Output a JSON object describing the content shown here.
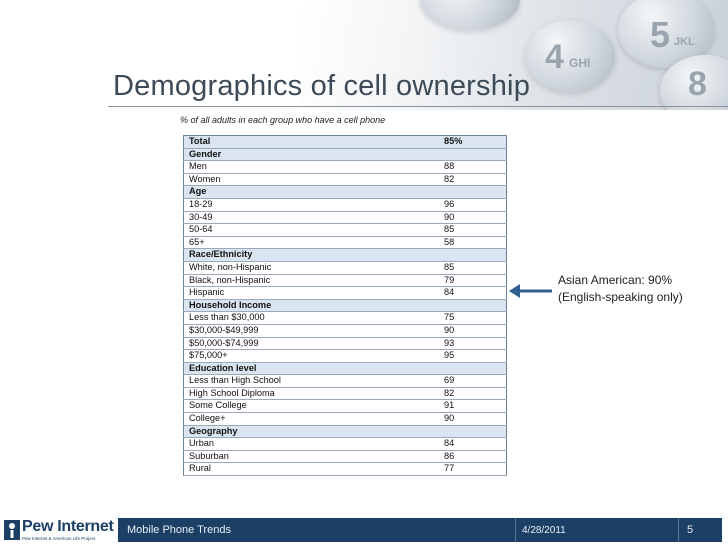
{
  "slide": {
    "title": "Demographics of cell ownership",
    "caption": "% of all adults in each group who have a cell phone",
    "note_line1": "Asian American: 90%",
    "note_line2": "(English-speaking only)"
  },
  "table": {
    "total": {
      "label": "Total",
      "value": "85%"
    },
    "sections": [
      {
        "header": "Gender",
        "rows": [
          {
            "label": "Men",
            "value": "88"
          },
          {
            "label": "Women",
            "value": "82"
          }
        ]
      },
      {
        "header": "Age",
        "rows": [
          {
            "label": "18-29",
            "value": "96"
          },
          {
            "label": "30-49",
            "value": "90"
          },
          {
            "label": "50-64",
            "value": "85"
          },
          {
            "label": "65+",
            "value": "58"
          }
        ]
      },
      {
        "header": "Race/Ethnicity",
        "rows": [
          {
            "label": "White, non-Hispanic",
            "value": "85"
          },
          {
            "label": "Black, non-Hispanic",
            "value": "79"
          },
          {
            "label": "Hispanic",
            "value": "84"
          }
        ]
      },
      {
        "header": "Household Income",
        "rows": [
          {
            "label": "Less than $30,000",
            "value": "75"
          },
          {
            "label": "$30,000-$49,999",
            "value": "90"
          },
          {
            "label": "$50,000-$74,999",
            "value": "93"
          },
          {
            "label": "$75,000+",
            "value": "95"
          }
        ]
      },
      {
        "header": "Education level",
        "rows": [
          {
            "label": "Less than High School",
            "value": "69"
          },
          {
            "label": "High School Diploma",
            "value": "82"
          },
          {
            "label": "Some College",
            "value": "91"
          },
          {
            "label": "College+",
            "value": "90"
          }
        ]
      },
      {
        "header": "Geography",
        "rows": [
          {
            "label": "Urban",
            "value": "84"
          },
          {
            "label": "Suburban",
            "value": "86"
          },
          {
            "label": "Rural",
            "value": "77"
          }
        ]
      }
    ]
  },
  "footer": {
    "logo": "Pew Internet",
    "logo_sub": "Pew Internet & American Life Project",
    "presentation": "Mobile Phone Trends",
    "date": "4/28/2011",
    "page": "5"
  },
  "keypad": {
    "digit_5": "5",
    "letters_5": "JKL",
    "digit_4": "4",
    "letters_4": "GHI",
    "digit_8": "8"
  },
  "colors": {
    "footer_bar": "#1c3f66",
    "section_fill": "#dbe5f1",
    "arrow": "#2f5f8f"
  }
}
